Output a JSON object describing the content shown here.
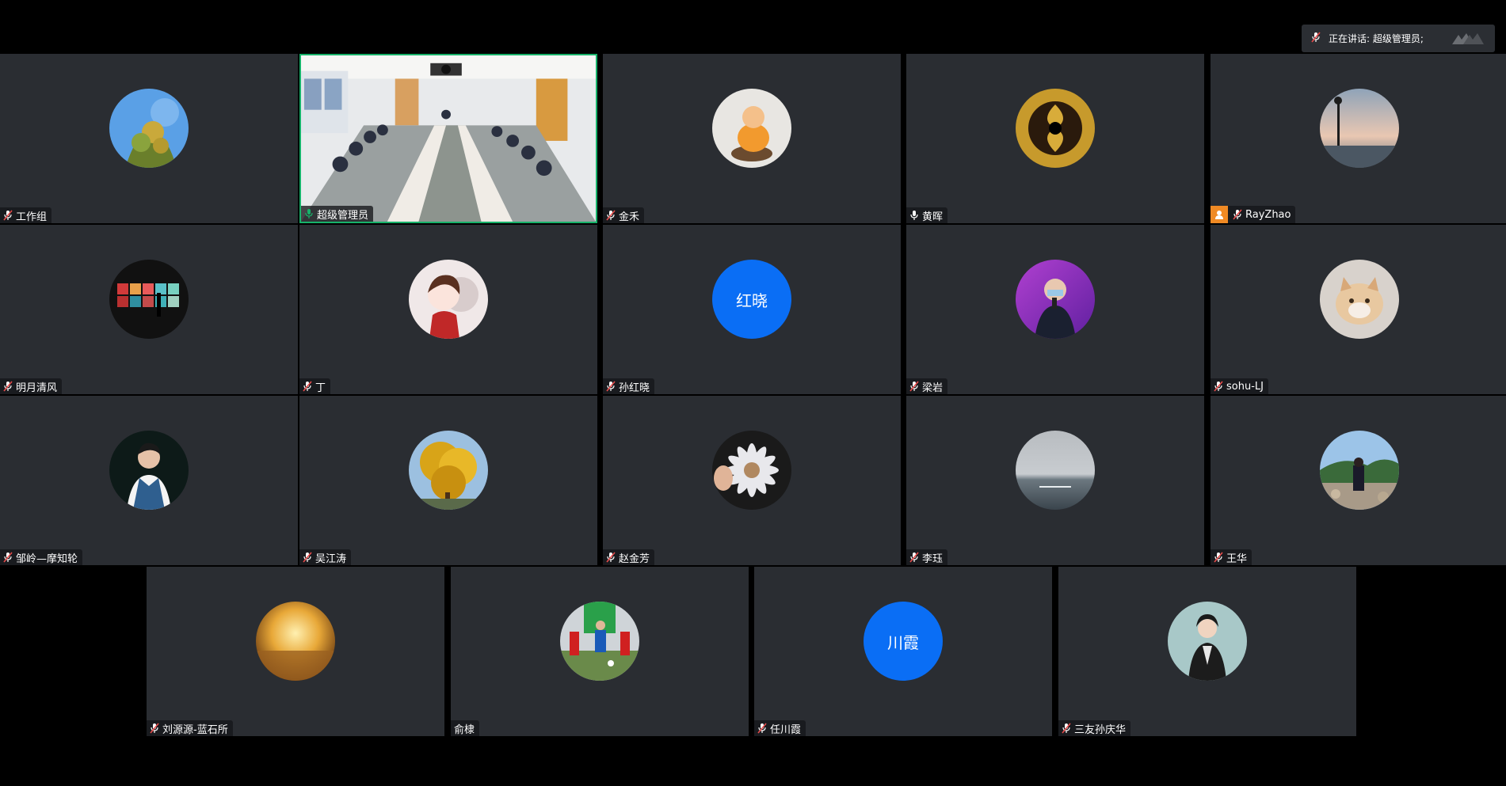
{
  "header": {
    "speaking_label": "正在讲话: 超级管理员;"
  },
  "colors": {
    "tile_bg": "#2a2d32",
    "active_border": "#17b26a",
    "text_avatar_bg": "#0a6ef5",
    "host_badge": "#f08a24",
    "mic_muted": "#e84c4c",
    "mic_on": "#17b26a"
  },
  "participants": [
    {
      "name": "工作组",
      "avatar": "photo-tree",
      "mic": "muted"
    },
    {
      "name": "超级管理员",
      "avatar": "video-meeting-room",
      "mic": "on"
    },
    {
      "name": "金禾",
      "avatar": "photo-monk-figure",
      "mic": "muted"
    },
    {
      "name": "黄晖",
      "avatar": "photo-gold-pattern",
      "mic": "unmuted"
    },
    {
      "name": "RayZhao",
      "avatar": "photo-sunset-lamp",
      "mic": "muted",
      "host": true
    },
    {
      "name": "明月清风",
      "avatar": "photo-window-silhouette",
      "mic": "muted"
    },
    {
      "name": "丁",
      "avatar": "photo-cartoon-girl",
      "mic": "muted"
    },
    {
      "name": "孙红晓",
      "avatar_text": "红晓",
      "mic": "muted"
    },
    {
      "name": "梁岩",
      "avatar": "photo-speaker",
      "mic": "muted"
    },
    {
      "name": "sohu-LJ",
      "avatar": "photo-cat",
      "mic": "muted"
    },
    {
      "name": "邹岭—摩知轮",
      "avatar": "photo-man-portrait",
      "mic": "muted"
    },
    {
      "name": "吴江涛",
      "avatar": "photo-ginkgo",
      "mic": "muted"
    },
    {
      "name": "赵金芳",
      "avatar": "photo-paper-flower",
      "mic": "muted"
    },
    {
      "name": "李珏",
      "avatar": "photo-sea",
      "mic": "muted"
    },
    {
      "name": "王华",
      "avatar": "photo-riverside",
      "mic": "muted"
    },
    {
      "name": "刘源源-蓝石所",
      "avatar": "photo-golden-field",
      "mic": "muted"
    },
    {
      "name": "俞棣",
      "avatar": "photo-football",
      "mic": "none"
    },
    {
      "name": "任川霞",
      "avatar_text": "川霞",
      "mic": "muted"
    },
    {
      "name": "三友孙庆华",
      "avatar": "photo-woman-portrait",
      "mic": "muted"
    }
  ]
}
